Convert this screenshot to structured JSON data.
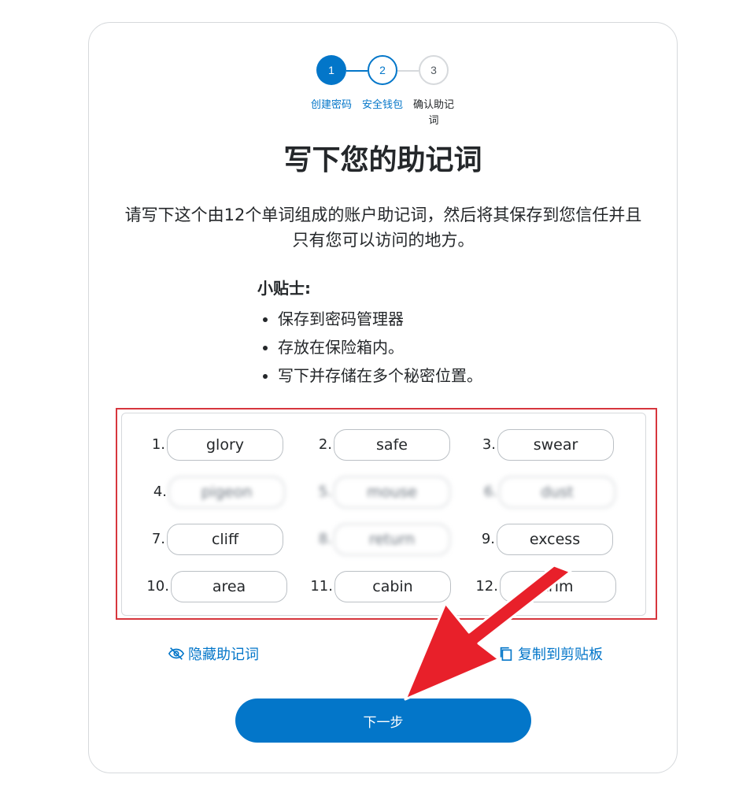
{
  "stepper": {
    "steps": [
      {
        "number": "1",
        "label": "创建密码"
      },
      {
        "number": "2",
        "label": "安全钱包"
      },
      {
        "number": "3",
        "label": "确认助记词"
      }
    ]
  },
  "page": {
    "title": "写下您的助记词",
    "description": "请写下这个由12个单词组成的账户助记词，然后将其保存到您信任并且只有您可以访问的地方。"
  },
  "tips": {
    "title": "小贴士:",
    "items": [
      "保存到密码管理器",
      "存放在保险箱内。",
      "写下并存储在多个秘密位置。"
    ]
  },
  "phrase": {
    "words": [
      {
        "index": "1.",
        "word": "glory"
      },
      {
        "index": "2.",
        "word": "safe"
      },
      {
        "index": "3.",
        "word": "swear"
      },
      {
        "index": "4.",
        "word": "pigeon"
      },
      {
        "index": "5.",
        "word": "mouse"
      },
      {
        "index": "6.",
        "word": "dust"
      },
      {
        "index": "7.",
        "word": "cliff"
      },
      {
        "index": "8.",
        "word": "return"
      },
      {
        "index": "9.",
        "word": "excess"
      },
      {
        "index": "10.",
        "word": "area"
      },
      {
        "index": "11.",
        "word": "cabin"
      },
      {
        "index": "12.",
        "word": "trim"
      }
    ]
  },
  "actions": {
    "hide_label": "隐藏助记词",
    "copy_label": "复制到剪贴板"
  },
  "footer": {
    "next_label": "下一步"
  },
  "colors": {
    "accent": "#0376c9",
    "highlight_frame": "#d7363d",
    "annotation_arrow": "#e8202a"
  },
  "icons": [
    "eye-slash-icon",
    "copy-icon"
  ]
}
